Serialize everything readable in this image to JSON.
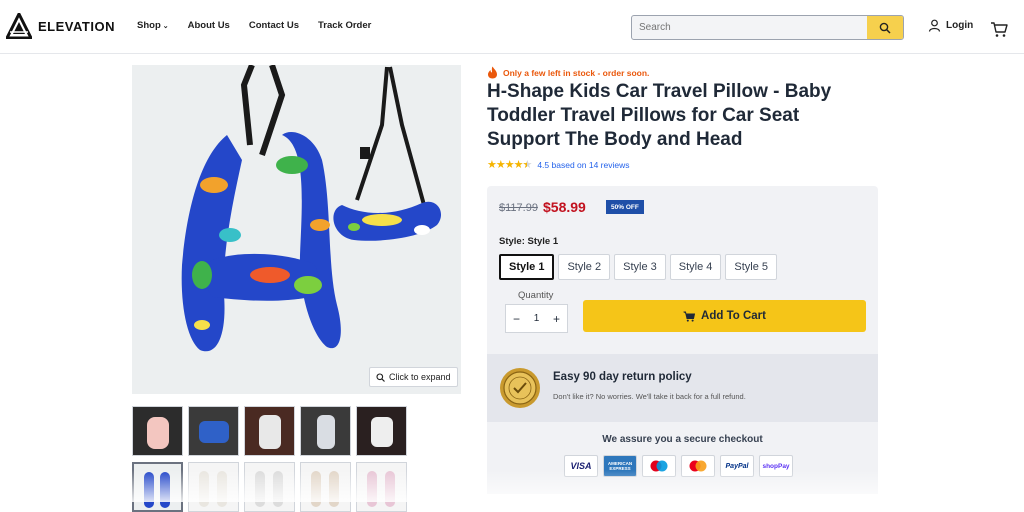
{
  "brand": {
    "name": "ELEVATION"
  },
  "nav": {
    "shop": "Shop",
    "about": "About Us",
    "contact": "Contact Us",
    "track": "Track Order"
  },
  "search": {
    "placeholder": "Search"
  },
  "account": {
    "login": "Login"
  },
  "gallery": {
    "expand_label": "Click to expand"
  },
  "product": {
    "stock_notice": "Only a few left in stock - order soon.",
    "title": "H-Shape Kids Car Travel Pillow - Baby Toddler Travel Pillows for Car Seat Support The Body and Head",
    "rating_value": 4.5,
    "rating_text": "4.5 based on 14 reviews",
    "old_price": "$117.99",
    "price": "$58.99",
    "discount": "50% OFF",
    "style_label": "Style: Style 1",
    "styles": [
      "Style 1",
      "Style 2",
      "Style 3",
      "Style 4",
      "Style 5"
    ],
    "quantity_label": "Quantity",
    "quantity": "1",
    "add_to_cart": "Add To Cart"
  },
  "policy": {
    "title": "Easy 90 day return policy",
    "subtitle": "Don't like it? No worries. We'll take it back for a full refund."
  },
  "checkout": {
    "title": "We assure you a secure checkout",
    "payments": [
      "VISA",
      "AMERICAN EXPRESS",
      "maestro",
      "mastercard",
      "PayPal",
      "shopPay"
    ]
  },
  "colors": {
    "accent": "#f5c518",
    "price": "#c2121f",
    "badge": "#1f4fa8",
    "stock": "#ea580c",
    "pillow": "#2447c9"
  }
}
